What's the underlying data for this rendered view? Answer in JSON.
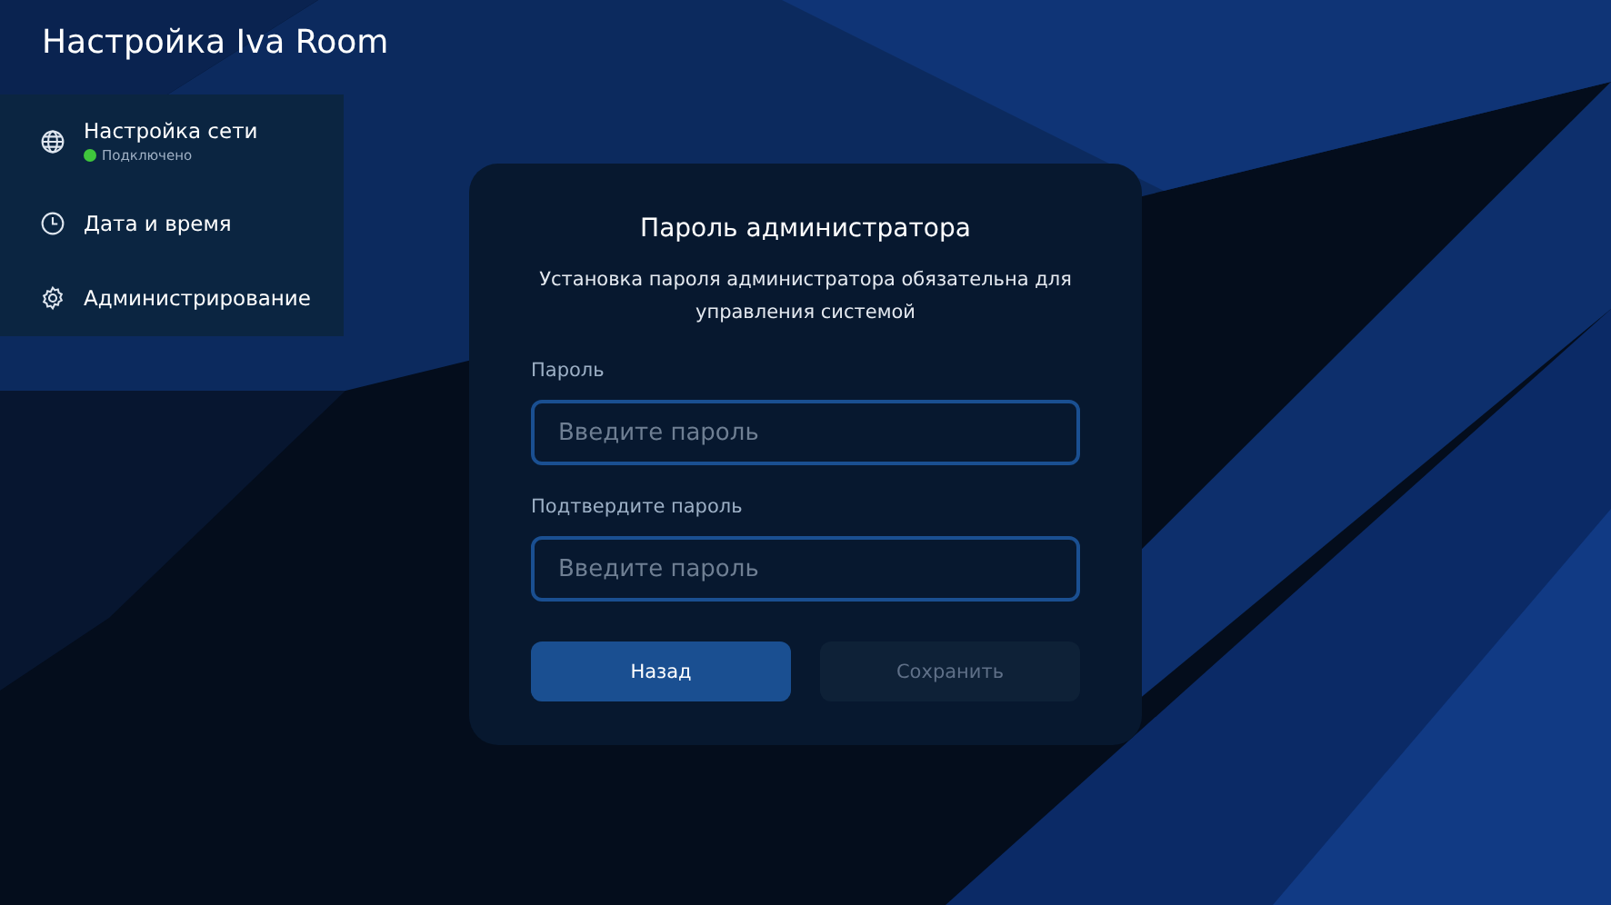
{
  "window": {
    "title": "Настройка Iva Room"
  },
  "sidebar": {
    "items": [
      {
        "label": "Настройка сети",
        "kind": "globe",
        "status": {
          "text": "Подключено",
          "color": "#3fc63c"
        }
      },
      {
        "label": "Дата и время",
        "kind": "clock"
      },
      {
        "label": "Администрирование",
        "kind": "gear"
      }
    ]
  },
  "dialog": {
    "title": "Пароль администратора",
    "description": "Установка пароля администратора обязательна для управления системой",
    "fields": [
      {
        "label": "Пароль",
        "placeholder": "Введите пароль"
      },
      {
        "label": "Подтвердите пароль",
        "placeholder": "Введите пароль"
      }
    ],
    "buttons": [
      {
        "label": "Назад",
        "disabled": false
      },
      {
        "label": "Сохранить",
        "disabled": true
      }
    ]
  }
}
